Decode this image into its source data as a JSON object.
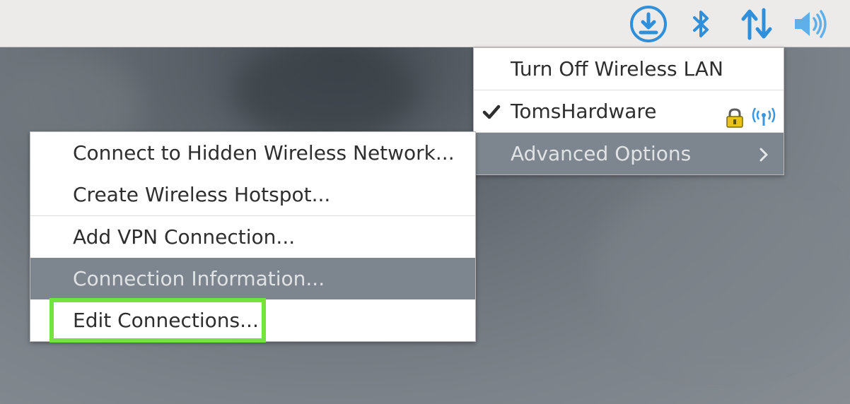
{
  "taskbar": {
    "icons": [
      "download-icon",
      "bluetooth-icon",
      "network-icon",
      "volume-icon"
    ],
    "accent": "#2f8fdb"
  },
  "network_menu": {
    "items": [
      {
        "label": "Turn Off Wireless LAN"
      },
      {
        "label": "TomsHardware",
        "checked": true,
        "icons": [
          "lock-icon",
          "wifi-signal-icon"
        ]
      },
      {
        "label": "Advanced Options",
        "submenu": true
      }
    ]
  },
  "advanced_menu": {
    "items": [
      {
        "label": "Connect to Hidden Wireless Network..."
      },
      {
        "label": "Create Wireless Hotspot..."
      },
      {
        "label": "Add VPN Connection..."
      },
      {
        "label": "Connection Information..."
      },
      {
        "label": "Edit Connections..."
      }
    ]
  },
  "highlight_color": "#76e23f",
  "hover_color": "#7d868e"
}
